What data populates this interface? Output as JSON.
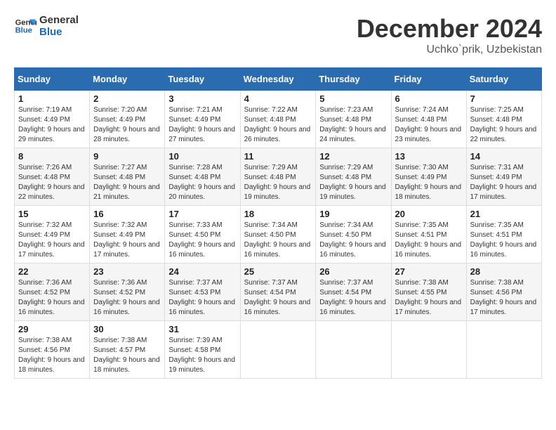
{
  "logo": {
    "line1": "General",
    "line2": "Blue"
  },
  "title": {
    "month": "December 2024",
    "location": "Uchko`prik, Uzbekistan"
  },
  "weekdays": [
    "Sunday",
    "Monday",
    "Tuesday",
    "Wednesday",
    "Thursday",
    "Friday",
    "Saturday"
  ],
  "weeks": [
    [
      {
        "day": "1",
        "sunrise": "7:19 AM",
        "sunset": "4:49 PM",
        "daylight": "9 hours and 29 minutes."
      },
      {
        "day": "2",
        "sunrise": "7:20 AM",
        "sunset": "4:49 PM",
        "daylight": "9 hours and 28 minutes."
      },
      {
        "day": "3",
        "sunrise": "7:21 AM",
        "sunset": "4:49 PM",
        "daylight": "9 hours and 27 minutes."
      },
      {
        "day": "4",
        "sunrise": "7:22 AM",
        "sunset": "4:48 PM",
        "daylight": "9 hours and 26 minutes."
      },
      {
        "day": "5",
        "sunrise": "7:23 AM",
        "sunset": "4:48 PM",
        "daylight": "9 hours and 24 minutes."
      },
      {
        "day": "6",
        "sunrise": "7:24 AM",
        "sunset": "4:48 PM",
        "daylight": "9 hours and 23 minutes."
      },
      {
        "day": "7",
        "sunrise": "7:25 AM",
        "sunset": "4:48 PM",
        "daylight": "9 hours and 22 minutes."
      }
    ],
    [
      {
        "day": "8",
        "sunrise": "7:26 AM",
        "sunset": "4:48 PM",
        "daylight": "9 hours and 22 minutes."
      },
      {
        "day": "9",
        "sunrise": "7:27 AM",
        "sunset": "4:48 PM",
        "daylight": "9 hours and 21 minutes."
      },
      {
        "day": "10",
        "sunrise": "7:28 AM",
        "sunset": "4:48 PM",
        "daylight": "9 hours and 20 minutes."
      },
      {
        "day": "11",
        "sunrise": "7:29 AM",
        "sunset": "4:48 PM",
        "daylight": "9 hours and 19 minutes."
      },
      {
        "day": "12",
        "sunrise": "7:29 AM",
        "sunset": "4:48 PM",
        "daylight": "9 hours and 19 minutes."
      },
      {
        "day": "13",
        "sunrise": "7:30 AM",
        "sunset": "4:49 PM",
        "daylight": "9 hours and 18 minutes."
      },
      {
        "day": "14",
        "sunrise": "7:31 AM",
        "sunset": "4:49 PM",
        "daylight": "9 hours and 17 minutes."
      }
    ],
    [
      {
        "day": "15",
        "sunrise": "7:32 AM",
        "sunset": "4:49 PM",
        "daylight": "9 hours and 17 minutes."
      },
      {
        "day": "16",
        "sunrise": "7:32 AM",
        "sunset": "4:49 PM",
        "daylight": "9 hours and 17 minutes."
      },
      {
        "day": "17",
        "sunrise": "7:33 AM",
        "sunset": "4:50 PM",
        "daylight": "9 hours and 16 minutes."
      },
      {
        "day": "18",
        "sunrise": "7:34 AM",
        "sunset": "4:50 PM",
        "daylight": "9 hours and 16 minutes."
      },
      {
        "day": "19",
        "sunrise": "7:34 AM",
        "sunset": "4:50 PM",
        "daylight": "9 hours and 16 minutes."
      },
      {
        "day": "20",
        "sunrise": "7:35 AM",
        "sunset": "4:51 PM",
        "daylight": "9 hours and 16 minutes."
      },
      {
        "day": "21",
        "sunrise": "7:35 AM",
        "sunset": "4:51 PM",
        "daylight": "9 hours and 16 minutes."
      }
    ],
    [
      {
        "day": "22",
        "sunrise": "7:36 AM",
        "sunset": "4:52 PM",
        "daylight": "9 hours and 16 minutes."
      },
      {
        "day": "23",
        "sunrise": "7:36 AM",
        "sunset": "4:52 PM",
        "daylight": "9 hours and 16 minutes."
      },
      {
        "day": "24",
        "sunrise": "7:37 AM",
        "sunset": "4:53 PM",
        "daylight": "9 hours and 16 minutes."
      },
      {
        "day": "25",
        "sunrise": "7:37 AM",
        "sunset": "4:54 PM",
        "daylight": "9 hours and 16 minutes."
      },
      {
        "day": "26",
        "sunrise": "7:37 AM",
        "sunset": "4:54 PM",
        "daylight": "9 hours and 16 minutes."
      },
      {
        "day": "27",
        "sunrise": "7:38 AM",
        "sunset": "4:55 PM",
        "daylight": "9 hours and 17 minutes."
      },
      {
        "day": "28",
        "sunrise": "7:38 AM",
        "sunset": "4:56 PM",
        "daylight": "9 hours and 17 minutes."
      }
    ],
    [
      {
        "day": "29",
        "sunrise": "7:38 AM",
        "sunset": "4:56 PM",
        "daylight": "9 hours and 18 minutes."
      },
      {
        "day": "30",
        "sunrise": "7:38 AM",
        "sunset": "4:57 PM",
        "daylight": "9 hours and 18 minutes."
      },
      {
        "day": "31",
        "sunrise": "7:39 AM",
        "sunset": "4:58 PM",
        "daylight": "9 hours and 19 minutes."
      },
      null,
      null,
      null,
      null
    ]
  ]
}
